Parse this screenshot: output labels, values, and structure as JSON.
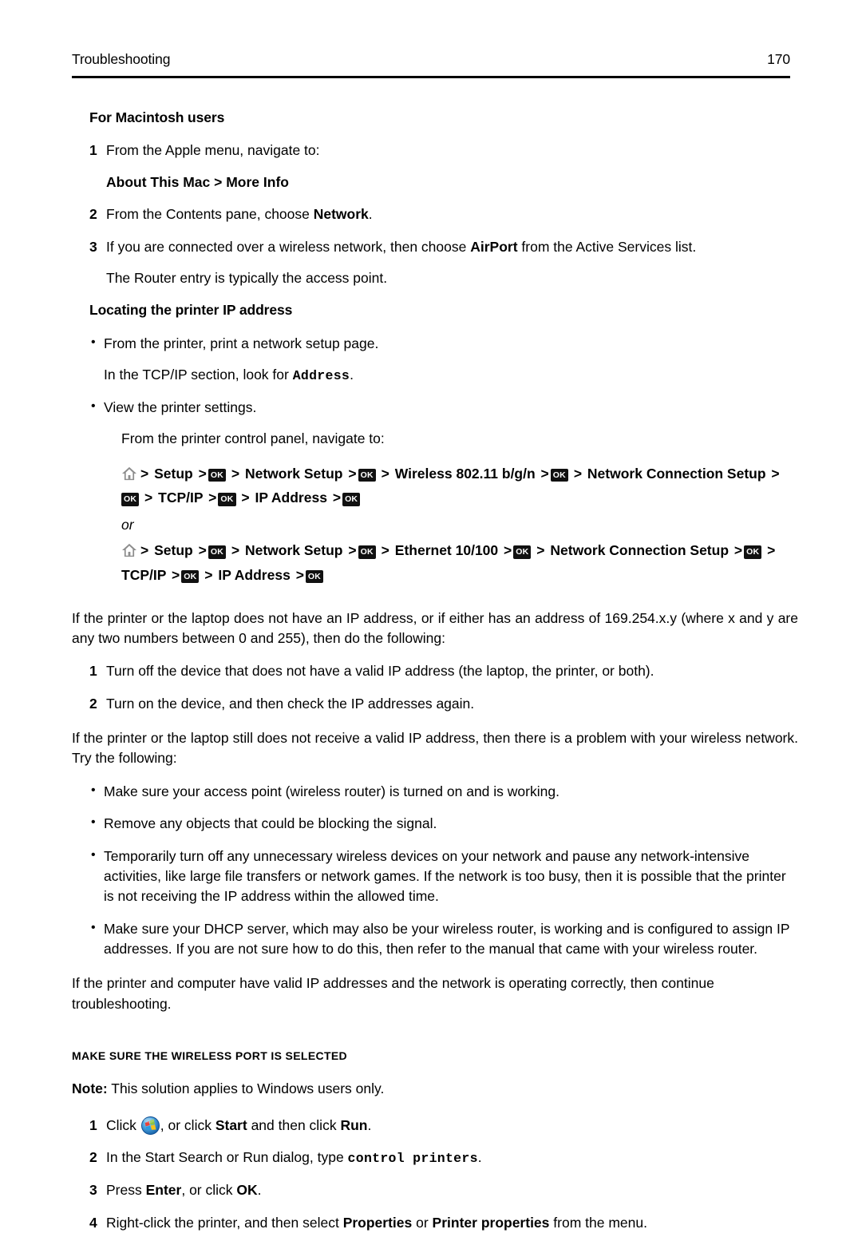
{
  "header": {
    "section_title": "Troubleshooting",
    "page_number": "170"
  },
  "sections": {
    "mac_heading": "For Macintosh users",
    "mac_steps": [
      {
        "num": "1",
        "text": "From the Apple menu, navigate to:",
        "sub_bold": "About This Mac > More Info"
      },
      {
        "num": "2",
        "pre": "From the Contents pane, choose ",
        "bold": "Network",
        "post": "."
      },
      {
        "num": "3",
        "pre": "If you are connected over a wireless network, then choose ",
        "bold": "AirPort",
        "post": " from the Active Services list.",
        "sub": "The Router entry is typically the access point."
      }
    ],
    "locating_heading": "Locating the printer IP address",
    "locating_bullets": [
      {
        "text": "From the printer, print a network setup page.",
        "sub_pre": "In the TCP/IP section, look for ",
        "sub_mono": "Address",
        "sub_post": "."
      },
      {
        "text": "View the printer settings.",
        "sub": "From the printer control panel, navigate to:"
      }
    ],
    "nav_path_wireless": {
      "home_icon": "home-icon",
      "ok_key": "OK",
      "separator": ">",
      "items": [
        "Setup",
        "Network Setup",
        "Wireless 802.11 b/g/n",
        "Network Connection Setup",
        "TCP/IP",
        "IP Address"
      ]
    },
    "or_label": "or",
    "nav_path_ethernet": {
      "home_icon": "home-icon",
      "ok_key": "OK",
      "separator": ">",
      "items": [
        "Setup",
        "Network Setup",
        "Ethernet 10/100",
        "Network Connection Setup",
        "TCP/IP",
        "IP Address"
      ]
    },
    "ip_paragraph": "If the printer or the laptop does not have an IP address, or if either has an address of 169.254.x.y (where x and y are any two numbers between 0 and 255), then do the following:",
    "ip_steps": [
      {
        "num": "1",
        "text": "Turn off the device that does not have a valid IP address (the laptop, the printer, or both)."
      },
      {
        "num": "2",
        "text": "Turn on the device, and then check the IP addresses again."
      }
    ],
    "wireless_problem_paragraph": "If the printer or the laptop still does not receive a valid IP address, then there is a problem with your wireless network. Try the following:",
    "wireless_bullets": [
      "Make sure your access point (wireless router) is turned on and is working.",
      "Remove any objects that could be blocking the signal.",
      "Temporarily turn off any unnecessary wireless devices on your network and pause any network-intensive activities, like large file transfers or network games. If the network is too busy, then it is possible that the printer is not receiving the IP address within the allowed time.",
      "Make sure your DHCP server, which may also be your wireless router, is working and is configured to assign IP addresses. If you are not sure how to do this, then refer to the manual that came with your wireless router."
    ],
    "continue_paragraph": "If the printer and computer have valid IP addresses and the network is operating correctly, then continue troubleshooting.",
    "wireless_port_heading": "Make sure the wireless port is selected",
    "note_label": "Note:",
    "note_text": " This solution applies to Windows users only.",
    "windows_steps": [
      {
        "num": "1",
        "pre": "Click ",
        "icon": "windows-start-orb-icon",
        "mid": ", or click ",
        "bold1": "Start",
        "mid2": " and then click ",
        "bold2": "Run",
        "post": "."
      },
      {
        "num": "2",
        "pre": "In the Start Search or Run dialog, type ",
        "mono": "control printers",
        "post": "."
      },
      {
        "num": "3",
        "pre": "Press ",
        "bold1": "Enter",
        "mid": ", or click ",
        "bold2": "OK",
        "post": "."
      },
      {
        "num": "4",
        "pre": "Right-click the printer, and then select ",
        "bold1": "Properties",
        "mid": " or ",
        "bold2": "Printer properties",
        "post": " from the menu."
      }
    ]
  },
  "colors": {
    "text": "#000000",
    "rule": "#000000",
    "ok_key_bg": "#111111",
    "ok_key_fg": "#ffffff",
    "home_icon": "#8d8d8d",
    "orb_blue": "#3b8fd4"
  }
}
